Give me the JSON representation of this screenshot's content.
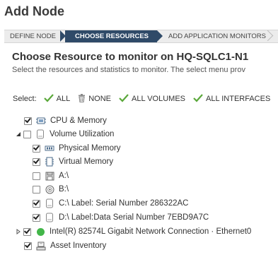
{
  "page": {
    "title": "Add Node"
  },
  "wizard": {
    "steps": [
      {
        "label": "DEFINE NODE",
        "state": "done"
      },
      {
        "label": "CHOOSE RESOURCES",
        "state": "active"
      },
      {
        "label": "ADD APPLICATION MONITORS",
        "state": "next"
      }
    ]
  },
  "main": {
    "heading": "Choose Resource to monitor on HQ-SQLC1-N1",
    "description": "Select the resources and statistics to monitor. The select menu prov"
  },
  "select_bar": {
    "label": "Select:",
    "all": "ALL",
    "none": "NONE",
    "all_volumes": "ALL VOLUMES",
    "all_interfaces": "ALL INTERFACES"
  },
  "tree": {
    "items": [
      {
        "label": "CPU & Memory",
        "checked": true,
        "icon": "cpu-icon",
        "level": 0,
        "expander": "none"
      },
      {
        "label": "Volume Utilization",
        "checked": false,
        "icon": "volume-icon",
        "level": 0,
        "expander": "expanded"
      },
      {
        "label": "Physical Memory",
        "checked": true,
        "icon": "memory-chip-icon",
        "level": 1,
        "expander": "none"
      },
      {
        "label": "Virtual Memory",
        "checked": true,
        "icon": "virtual-memory-icon",
        "level": 1,
        "expander": "none"
      },
      {
        "label": "A:\\",
        "checked": false,
        "icon": "floppy-icon",
        "level": 1,
        "expander": "none"
      },
      {
        "label": "B:\\",
        "checked": false,
        "icon": "disc-icon",
        "level": 1,
        "expander": "none"
      },
      {
        "label": "C:\\ Label: Serial Number 286322AC",
        "checked": true,
        "icon": "disk-icon",
        "level": 1,
        "expander": "none"
      },
      {
        "label": "D:\\ Label:Data Serial Number 7EBD9A7C",
        "checked": true,
        "icon": "disk-icon",
        "level": 1,
        "expander": "none"
      },
      {
        "label": "Intel(R) 82574L Gigabit Network Connection · Ethernet0",
        "checked": true,
        "icon": "status-up-icon",
        "level": 0,
        "expander": "collapsed"
      },
      {
        "label": "Asset Inventory",
        "checked": true,
        "icon": "asset-inventory-icon",
        "level": 0,
        "expander": "none"
      }
    ]
  },
  "colors": {
    "wizard_active": "#2f4a68",
    "check_green": "#5aa83a",
    "status_up": "#42b649"
  }
}
